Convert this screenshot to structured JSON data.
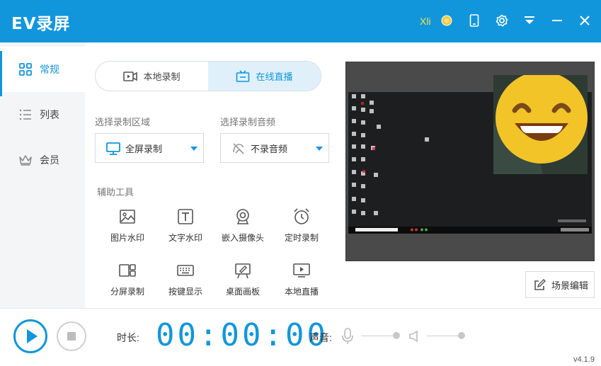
{
  "app": {
    "title": "EV录屏",
    "user": "Xli"
  },
  "sidebar": {
    "items": [
      {
        "label": "常规"
      },
      {
        "label": "列表"
      },
      {
        "label": "会员"
      }
    ]
  },
  "mode": {
    "local": "本地录制",
    "live": "在线直播"
  },
  "region": {
    "label": "选择录制区域",
    "value": "全屏录制"
  },
  "audio": {
    "label": "选择录制音频",
    "value": "不录音频"
  },
  "tools": {
    "label": "辅助工具",
    "items": [
      {
        "label": "图片水印"
      },
      {
        "label": "文字水印"
      },
      {
        "label": "嵌入摄像头"
      },
      {
        "label": "定时录制"
      },
      {
        "label": "分屏录制"
      },
      {
        "label": "按键显示"
      },
      {
        "label": "桌面画板"
      },
      {
        "label": "本地直播"
      }
    ]
  },
  "scene_button": "场景编辑",
  "bottom": {
    "duration_label": "时长:",
    "timer": "00:00:00",
    "sound_label": "声音:",
    "version": "v4.1.9"
  },
  "colors": {
    "accent": "#1296db",
    "active_bg": "#dff0fb"
  }
}
